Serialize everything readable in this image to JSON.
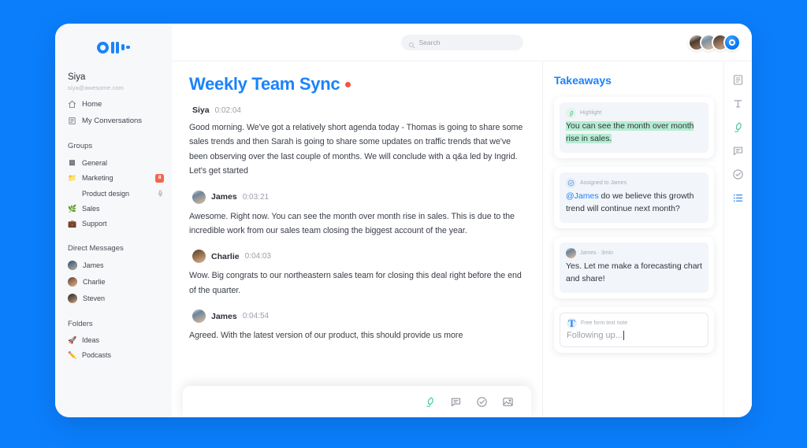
{
  "app": {
    "logo_name": "otter-logo",
    "background_color": "#0b7efc",
    "accent_color": "#1a83fb",
    "highlight_color": "#b6ecd2",
    "record_color": "#f4543c"
  },
  "sidebar": {
    "user": {
      "name": "Siya",
      "email": "siya@awesome.com"
    },
    "nav": [
      {
        "label": "Home",
        "icon": "home-icon"
      },
      {
        "label": "My Conversations",
        "icon": "conversations-icon"
      }
    ],
    "groups": {
      "label": "Groups",
      "items": [
        {
          "label": "General",
          "emoji": "▩",
          "badge": "",
          "mic": false,
          "sub": false
        },
        {
          "label": "Marketing",
          "emoji": "📁",
          "badge": "8",
          "mic": false,
          "sub": false
        },
        {
          "label": "Product design",
          "emoji": "",
          "badge": "",
          "mic": true,
          "sub": true
        },
        {
          "label": "Sales",
          "emoji": "🌿",
          "badge": "",
          "mic": false,
          "sub": false
        },
        {
          "label": "Support",
          "emoji": "💼",
          "badge": "",
          "mic": false,
          "sub": false
        }
      ]
    },
    "direct_messages": {
      "label": "Direct Messages",
      "items": [
        {
          "label": "James"
        },
        {
          "label": "Charlie"
        },
        {
          "label": "Steven"
        }
      ]
    },
    "folders": {
      "label": "Folders",
      "items": [
        {
          "label": "Ideas",
          "emoji": "🚀"
        },
        {
          "label": "Podcasts",
          "emoji": "✏️"
        }
      ]
    }
  },
  "topbar": {
    "search_placeholder": "Search",
    "search_value": "",
    "avatars": [
      "avatar-1",
      "avatar-2",
      "avatar-3"
    ],
    "record_button": "record-button"
  },
  "transcript": {
    "title": "Weekly Team Sync",
    "recording": true,
    "entries": [
      {
        "speaker": "Siya",
        "time": "0:02:04",
        "has_avatar": false,
        "text": "Good morning. We've got a relatively short agenda today - Thomas is going to share some sales trends and then Sarah is going to share some updates on traffic trends that we've been observing over the last couple of months. We will conclude with a q&a led by Ingrid. Let's get started"
      },
      {
        "speaker": "James",
        "time": "0:03:21",
        "has_avatar": true,
        "text": "Awesome. Right now. You can see the month over month rise in sales. This is due to the incredible work from our sales team closing the biggest account of the year."
      },
      {
        "speaker": "Charlie",
        "time": "0:04:03",
        "has_avatar": true,
        "text": "Wow. Big congrats to our northeastern sales team for closing this deal right before the end of the quarter."
      },
      {
        "speaker": "James",
        "time": "0:04:54",
        "has_avatar": true,
        "text": "Agreed. With the latest version of our product, this should provide us more"
      }
    ],
    "toolbar": [
      {
        "icon": "highlighter-icon"
      },
      {
        "icon": "comment-icon"
      },
      {
        "icon": "check-circle-icon"
      },
      {
        "icon": "image-icon"
      }
    ]
  },
  "takeaways": {
    "title": "Takeaways",
    "cards": [
      {
        "kind": "highlight",
        "icon": "highlighter-icon",
        "label": "Highlight",
        "text": "You can see the month over month rise in sales."
      },
      {
        "kind": "action",
        "icon": "check-circle-icon",
        "label": "Assigned to James",
        "mention": "@James",
        "text": " do we believe this growth trend will continue next month?"
      },
      {
        "kind": "comment",
        "icon": "avatar-icon",
        "label": "James · 3min",
        "text": "Yes. Let me make a forecasting chart and share!"
      },
      {
        "kind": "note",
        "icon": "text-icon",
        "label": "Free form text note",
        "text": "Following up..."
      }
    ]
  },
  "rail": {
    "items": [
      {
        "icon": "transcript-icon",
        "active": false
      },
      {
        "icon": "text-icon",
        "active": false
      },
      {
        "icon": "highlighter-icon",
        "active": true
      },
      {
        "icon": "comment-icon",
        "active": false
      },
      {
        "icon": "check-circle-icon",
        "active": false
      },
      {
        "icon": "list-icon",
        "active": true
      }
    ]
  }
}
